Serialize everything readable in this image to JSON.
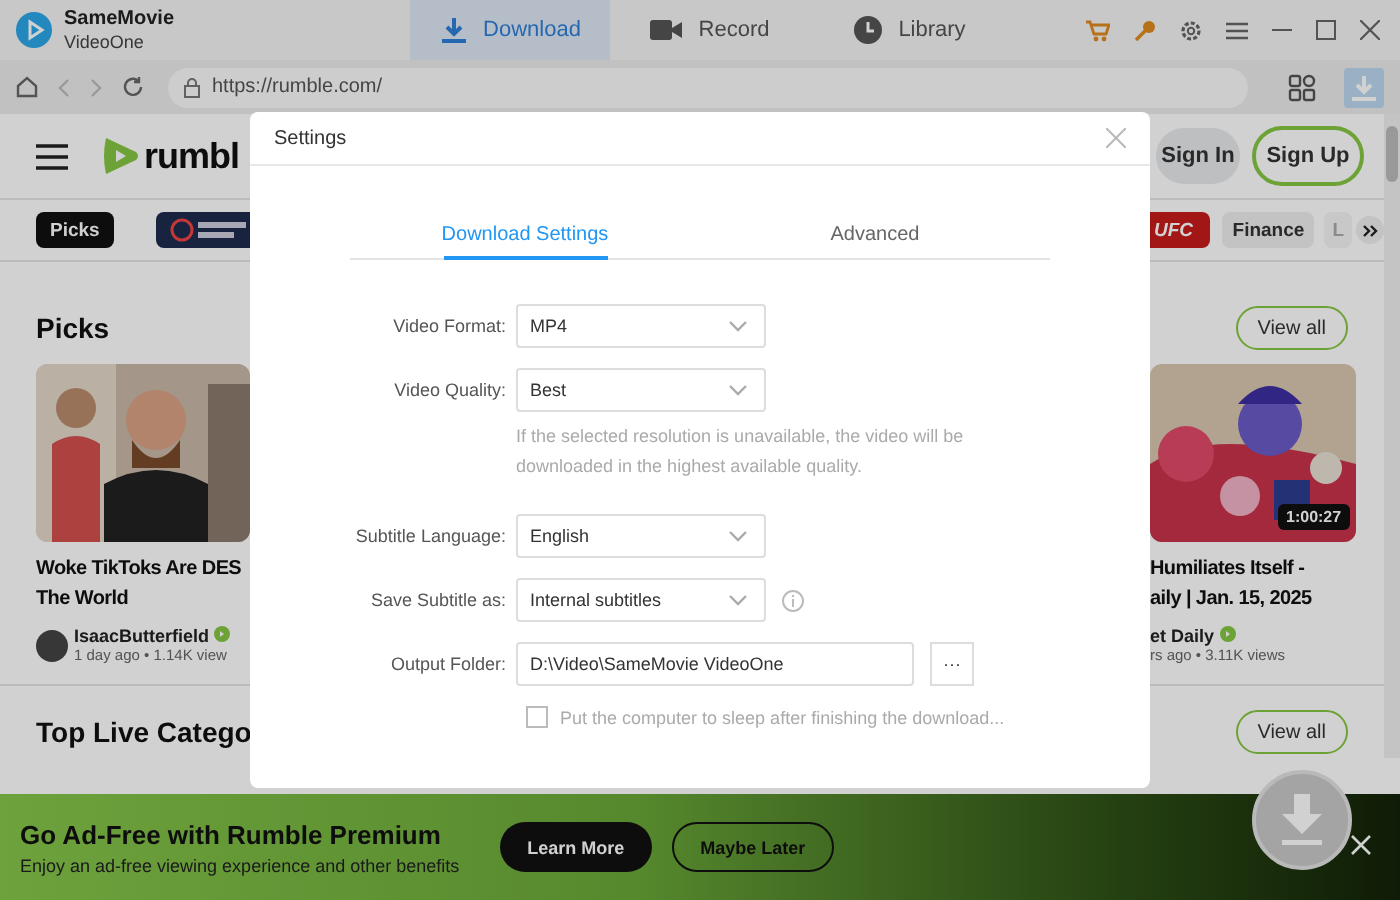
{
  "app": {
    "name": "SameMovie",
    "subtitle": "VideoOne"
  },
  "tabs": [
    {
      "label": "Download",
      "selected": true
    },
    {
      "label": "Record",
      "selected": false
    },
    {
      "label": "Library",
      "selected": false
    }
  ],
  "browser": {
    "url": "https://rumble.com/"
  },
  "site": {
    "logo_text": "rumbl",
    "sign_in": "Sign In",
    "sign_up": "Sign Up",
    "chips": [
      {
        "kind": "dark",
        "label": "Picks"
      },
      {
        "kind": "logo"
      },
      {
        "kind": "brand",
        "label": "UFC"
      },
      {
        "kind": "plain",
        "label": "Finance"
      },
      {
        "kind": "faded",
        "label": "L"
      }
    ],
    "picks": {
      "title": "Picks",
      "action": "View all"
    },
    "left_video": {
      "title": [
        "Woke TikToks Are DES",
        "The World"
      ],
      "author": "IsaacButterfield",
      "meta": "1 day ago • 1.14K view"
    },
    "right_video": {
      "title": [
        "Humiliates Itself -",
        "aily | Jan. 15, 2025"
      ],
      "duration": "1:00:27",
      "author": "et Daily",
      "meta": "rs ago • 3.11K views"
    },
    "live": {
      "title": "Top Live Catego",
      "action": "View all"
    },
    "banner": {
      "title": "Go Ad-Free with Rumble Premium",
      "text": "Enjoy an ad-free viewing experience and other benefits",
      "primary": "Learn More",
      "secondary": "Maybe Later"
    }
  },
  "dialog": {
    "title": "Settings",
    "tabs": [
      {
        "label": "Download Settings",
        "selected": true
      },
      {
        "label": "Advanced",
        "selected": false
      }
    ],
    "fields": [
      {
        "kind": "select",
        "label": "Video Format:",
        "value": "MP4"
      },
      {
        "kind": "select",
        "label": "Video Quality:",
        "value": "Best",
        "hint": "If the selected resolution is unavailable, the video will be downloaded in the highest available quality."
      },
      {
        "kind": "select",
        "label": "Subtitle Language:",
        "value": "English"
      },
      {
        "kind": "select_info",
        "label": "Save Subtitle as:",
        "value": "Internal subtitles"
      },
      {
        "kind": "folder",
        "label": "Output Folder:",
        "value": "D:\\Video\\SameMovie VideoOne",
        "button": "···"
      }
    ],
    "sleep": {
      "label": "Put the computer to sleep after finishing the download...",
      "checked": false
    }
  }
}
